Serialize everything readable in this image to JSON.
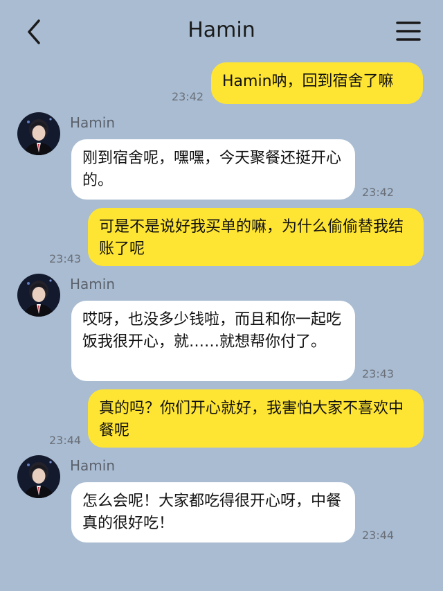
{
  "header": {
    "back_icon": "chevron-left-icon",
    "title": "Hamin",
    "menu_icon": "hamburger-menu-icon"
  },
  "colors": {
    "background": "#a9bcd2",
    "outgoing_bubble": "#ffe533",
    "incoming_bubble": "#ffffff"
  },
  "messages": [
    {
      "direction": "out",
      "text": "Hamin呐，回到宿舍了嘛",
      "time": "23:42"
    },
    {
      "direction": "in",
      "sender": "Hamin",
      "text": "刚到宿舍呢，嘿嘿，今天聚餐还挺开心的。",
      "time": "23:42"
    },
    {
      "direction": "out",
      "text": "可是不是说好我买单的嘛，为什么偷偷替我结账了呢",
      "time": "23:43"
    },
    {
      "direction": "in",
      "sender": "Hamin",
      "text": "哎呀，也没多少钱啦，而且和你一起吃饭我很开心，就……就想帮你付了。",
      "time": "23:43"
    },
    {
      "direction": "out",
      "text": "真的吗？你们开心就好，我害怕大家不喜欢中餐呢",
      "time": "23:44"
    },
    {
      "direction": "in",
      "sender": "Hamin",
      "text": "怎么会呢！大家都吃得很开心呀，中餐真的很好吃！",
      "time": "23:44"
    }
  ]
}
